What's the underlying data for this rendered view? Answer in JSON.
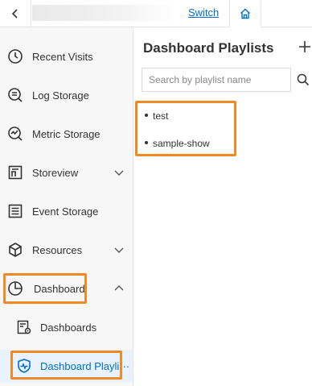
{
  "topbar": {
    "switch_label": "Switch"
  },
  "sidebar": {
    "items": [
      {
        "label": "Recent Visits"
      },
      {
        "label": "Log Storage"
      },
      {
        "label": "Metric Storage"
      },
      {
        "label": "Storeview"
      },
      {
        "label": "Event Storage"
      },
      {
        "label": "Resources"
      },
      {
        "label": "Dashboard"
      }
    ],
    "subitems": [
      {
        "label": "Dashboards"
      },
      {
        "label": "Dashboard Playli···"
      }
    ]
  },
  "main": {
    "title": "Dashboard Playlists",
    "search_placeholder": "Search by playlist name",
    "playlists": [
      "test",
      "sample-show"
    ]
  },
  "colors": {
    "accent": "#0070cc",
    "highlight": "#f08a24",
    "sidebar_bg": "#f7f7f7",
    "active_bg": "#e8f3ff"
  }
}
